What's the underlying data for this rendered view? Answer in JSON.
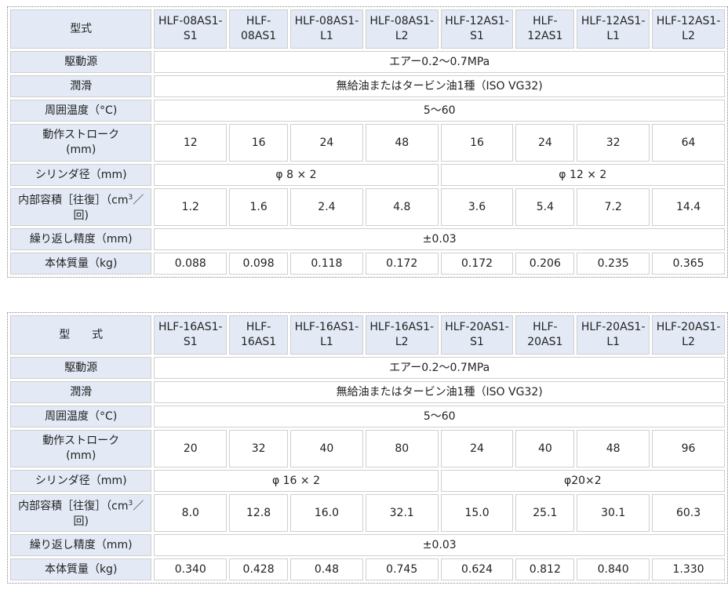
{
  "tables": [
    {
      "model_label": "型式",
      "models": [
        "HLF-08AS1-\nS1",
        "HLF-\n08AS1",
        "HLF-08AS1-\nL1",
        "HLF-08AS1-\nL2",
        "HLF-12AS1-\nS1",
        "HLF-\n12AS1",
        "HLF-12AS1-\nL1",
        "HLF-12AS1-\nL2"
      ],
      "drive_label": "駆動源",
      "drive_value": "エアー0.2～0.7MPa",
      "lube_label": "潤滑",
      "lube_value": "無給油またはタービン油1種（ISO VG32)",
      "temp_label": "周囲温度（°C)",
      "temp_value": "5～60",
      "stroke_label": "動作ストローク\n(mm)",
      "stroke_values": [
        "12",
        "16",
        "24",
        "48",
        "16",
        "24",
        "32",
        "64"
      ],
      "bore_label": "シリンダ径（mm)",
      "bore_values": [
        "φ 8 × 2",
        "φ 12 × 2"
      ],
      "volume_label_a": "内部容積［往復］（cm",
      "volume_label_sup": "3",
      "volume_label_b": "／\n回)",
      "volume_values": [
        "1.2",
        "1.6",
        "2.4",
        "4.8",
        "3.6",
        "5.4",
        "7.2",
        "14.4"
      ],
      "repeat_label": "繰り返し精度（mm)",
      "repeat_value": "±0.03",
      "mass_label": "本体質量（kg)",
      "mass_values": [
        "0.088",
        "0.098",
        "0.118",
        "0.172",
        "0.172",
        "0.206",
        "0.235",
        "0.365"
      ]
    },
    {
      "model_label": "型　　式",
      "models": [
        "HLF-16AS1-\nS1",
        "HLF-\n16AS1",
        "HLF-16AS1-\nL1",
        "HLF-16AS1-\nL2",
        "HLF-20AS1-\nS1",
        "HLF-\n20AS1",
        "HLF-20AS1-\nL1",
        "HLF-20AS1-\nL2"
      ],
      "drive_label": "駆動源",
      "drive_value": "エアー0.2～0.7MPa",
      "lube_label": "潤滑",
      "lube_value": "無給油またはタービン油1種（ISO VG32)",
      "temp_label": "周囲温度（°C)",
      "temp_value": "5～60",
      "stroke_label": "動作ストローク\n(mm)",
      "stroke_values": [
        "20",
        "32",
        "40",
        "80",
        "24",
        "40",
        "48",
        "96"
      ],
      "bore_label": "シリンダ径（mm)",
      "bore_values": [
        "φ 16 × 2",
        "φ20×2"
      ],
      "volume_label_a": "内部容積［往復］（cm",
      "volume_label_sup": "3",
      "volume_label_b": "／\n回)",
      "volume_values": [
        "8.0",
        "12.8",
        "16.0",
        "32.1",
        "15.0",
        "25.1",
        "30.1",
        "60.3"
      ],
      "repeat_label": "繰り返し精度（mm)",
      "repeat_value": "±0.03",
      "mass_label": "本体質量（kg)",
      "mass_values": [
        "0.340",
        "0.428",
        "0.48",
        "0.745",
        "0.624",
        "0.812",
        "0.840",
        "1.330"
      ]
    }
  ]
}
